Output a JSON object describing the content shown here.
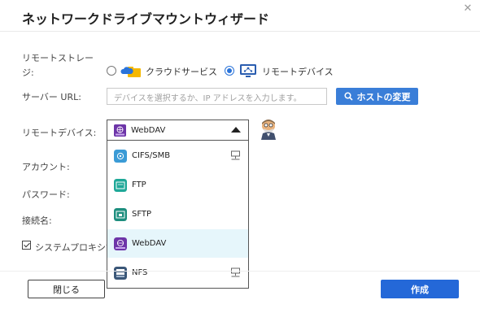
{
  "dialog": {
    "title": "ネットワークドライブマウントウィザード",
    "close_symbol": "✕"
  },
  "form": {
    "remote_storage_label_line1": "リモートストレー",
    "remote_storage_label_line2": "ジ:",
    "storage_options": [
      {
        "label": "クラウドサービス",
        "icon": "cloud-service-icon",
        "checked": false
      },
      {
        "label": "リモートデバイス",
        "icon": "remote-device-icon",
        "checked": true
      }
    ],
    "server_url_label": "サーバー URL:",
    "server_url_placeholder": "デバイスを選択するか、IP アドレスを入力します。",
    "change_host_button": "ホストの変更",
    "remote_device_label": "リモートデバイス:",
    "account_label": "アカウント:",
    "password_label": "パスワード:",
    "connection_name_label": "接続名:",
    "proxy_checkbox_label": "システムプロキシ設定",
    "proxy_checked": true
  },
  "remote_device_select": {
    "selected": "WebDAV",
    "expanded": true,
    "options": [
      {
        "label": "CIFS/SMB",
        "icon": "cifs-smb-icon",
        "color": "#3b9bd6",
        "network_icon": true
      },
      {
        "label": "FTP",
        "icon": "ftp-icon",
        "color": "#1fa898",
        "network_icon": false
      },
      {
        "label": "SFTP",
        "icon": "sftp-icon",
        "color": "#1d8e7e",
        "network_icon": false
      },
      {
        "label": "WebDAV",
        "icon": "webdav-icon",
        "color": "#6d35a8",
        "network_icon": false,
        "highlighted": true
      },
      {
        "label": "NFS",
        "icon": "nfs-icon",
        "color": "#3b5778",
        "network_icon": true
      }
    ]
  },
  "footer": {
    "close_button": "閉じる",
    "create_button": "作成"
  },
  "colors": {
    "primary_button": "#2468d8",
    "host_button": "#3a7ed8",
    "highlight_row": "#e6f6fb"
  }
}
